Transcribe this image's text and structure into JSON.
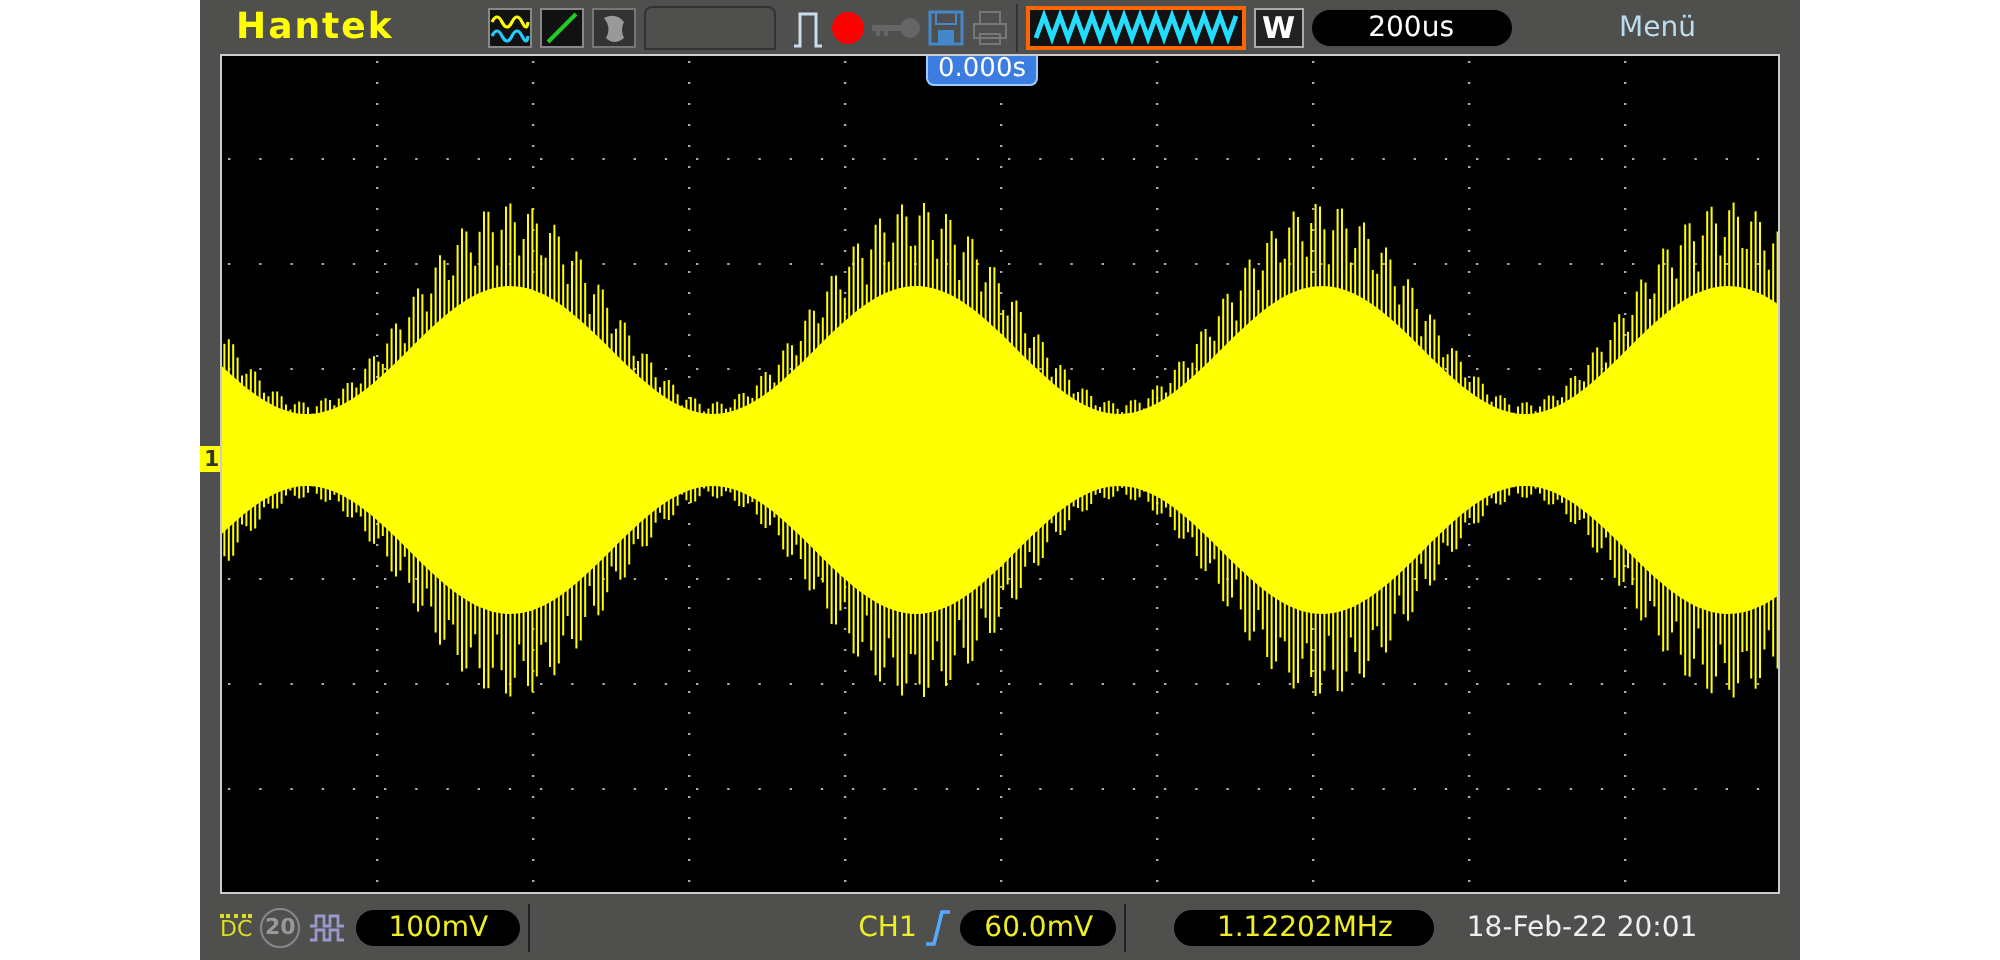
{
  "brand": "Hantek",
  "top_bar": {
    "mode_letter": "W",
    "timebase": "200us",
    "menu": "Menü"
  },
  "display": {
    "trigger_position": "0.000s",
    "channel_marker": "1"
  },
  "bottom_bar": {
    "coupling": "DC",
    "bandwidth_limit": "20",
    "volts_per_div": "100mV",
    "trigger_source": "CH1",
    "trigger_level": "60.0mV",
    "frequency": "1.12202MHz",
    "datetime": "18-Feb-22 20:01"
  }
}
